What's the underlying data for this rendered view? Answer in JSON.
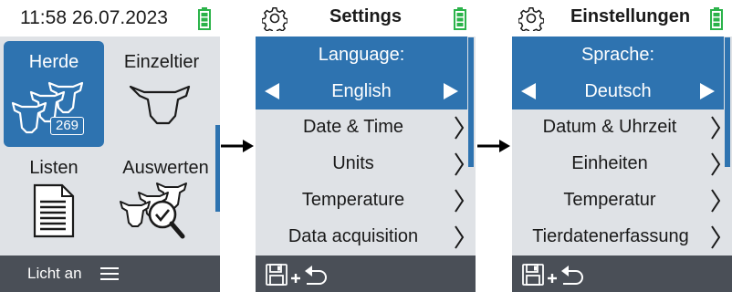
{
  "home": {
    "time_date": "11:58 26.07.2023",
    "tiles": [
      {
        "label": "Herde",
        "badge": "269"
      },
      {
        "label": "Einzeltier"
      },
      {
        "label": "Listen"
      },
      {
        "label": "Auswerten"
      }
    ],
    "bottom_label": "Licht an"
  },
  "settings_en": {
    "title": "Settings",
    "language_label": "Language:",
    "language_value": "English",
    "items": [
      "Date & Time",
      "Units",
      "Temperature",
      "Data acquisition"
    ]
  },
  "settings_de": {
    "title": "Einstellungen",
    "language_label": "Sprache:",
    "language_value": "Deutsch",
    "items": [
      "Datum & Uhrzeit",
      "Einheiten",
      "Temperatur",
      "Tierdatenerfassung"
    ]
  },
  "colors": {
    "accent": "#2e73b0",
    "panel": "#dfe2e6",
    "bottom_bar": "#4a4f57",
    "battery": "#2bb34a"
  },
  "icons": {
    "status": [
      "gear-icon",
      "battery-icon"
    ],
    "tiles": [
      "herd-cows-icon",
      "single-cow-icon",
      "document-list-icon",
      "evaluate-magnifier-icon"
    ],
    "nav": [
      "arrow-left-icon",
      "arrow-right-icon",
      "chevron-right-icon",
      "menu-icon",
      "save-back-icon",
      "flow-arrow-icon"
    ]
  }
}
